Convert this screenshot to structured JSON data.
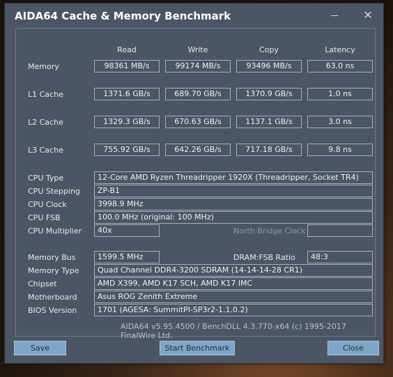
{
  "window": {
    "title": "AIDA64 Cache & Memory Benchmark",
    "close_glyph": "✕"
  },
  "headers": {
    "read": "Read",
    "write": "Write",
    "copy": "Copy",
    "latency": "Latency"
  },
  "rows": [
    {
      "label": "Memory",
      "read": "98361 MB/s",
      "write": "99174 MB/s",
      "copy": "93496 MB/s",
      "latency": "63.0 ns"
    },
    {
      "label": "L1 Cache",
      "read": "1371.6 GB/s",
      "write": "689.70 GB/s",
      "copy": "1370.9 GB/s",
      "latency": "1.0 ns"
    },
    {
      "label": "L2 Cache",
      "read": "1329.3 GB/s",
      "write": "670.63 GB/s",
      "copy": "1137.1 GB/s",
      "latency": "3.0 ns"
    },
    {
      "label": "L3 Cache",
      "read": "755.92 GB/s",
      "write": "642.26 GB/s",
      "copy": "717.18 GB/s",
      "latency": "9.8 ns"
    }
  ],
  "cpu": {
    "type_label": "CPU Type",
    "type": "12-Core AMD Ryzen Threadripper 1920X  (Threadripper, Socket TR4)",
    "stepping_label": "CPU Stepping",
    "stepping": "ZP-B1",
    "clock_label": "CPU Clock",
    "clock": "3998.9 MHz",
    "fsb_label": "CPU FSB",
    "fsb": "100.0 MHz  (original: 100 MHz)",
    "multiplier_label": "CPU Multiplier",
    "multiplier": "40x",
    "nb_clock_label": "North Bridge Clock",
    "nb_clock": ""
  },
  "memory": {
    "bus_label": "Memory Bus",
    "bus": "1599.5 MHz",
    "ratio_label": "DRAM:FSB Ratio",
    "ratio": "48:3",
    "type_label": "Memory Type",
    "type": "Quad Channel DDR4-3200 SDRAM  (14-14-14-28 CR1)",
    "chipset_label": "Chipset",
    "chipset": "AMD X399, AMD K17 SCH, AMD K17 IMC",
    "motherboard_label": "Motherboard",
    "motherboard": "Asus ROG Zenith Extreme",
    "bios_label": "BIOS Version",
    "bios": "1701  (AGESA: SummitPI-SP3r2-1.1.0.2)"
  },
  "footer": "AIDA64 v5.95.4500 / BenchDLL 4.3.770-x64  (c) 1995-2017 FinalWire Ltd.",
  "buttons": {
    "save": "Save",
    "start": "Start Benchmark",
    "close": "Close"
  }
}
